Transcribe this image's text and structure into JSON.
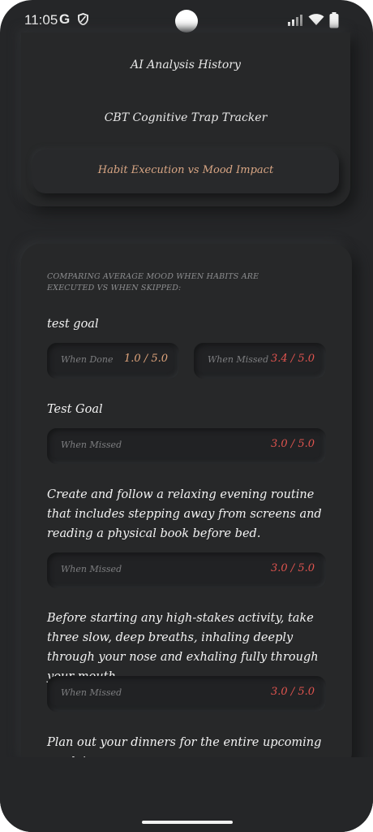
{
  "status": {
    "time": "11:05",
    "google": "G"
  },
  "nav": {
    "item1": "AI Analysis History",
    "item2": "CBT Cognitive Trap Tracker",
    "item3_active": "Habit Execution vs Mood Impact"
  },
  "main": {
    "subtitle": "COMPARING AVERAGE MOOD WHEN HABITS ARE EXECUTED VS WHEN SKIPPED:",
    "habits": [
      {
        "title": "test goal",
        "done_label": "When Done",
        "done_value": "1.0 / 5.0",
        "missed_label": "When Missed",
        "missed_value": "3.4 / 5.0"
      },
      {
        "title": "Test Goal",
        "missed_label": "When Missed",
        "missed_value": "3.0 / 5.0"
      },
      {
        "title": "Create and follow a relaxing evening routine that includes stepping away from screens and reading a physical book before bed.",
        "missed_label": "When Missed",
        "missed_value": "3.0 / 5.0"
      },
      {
        "title": "Before starting any high-stakes activity, take three slow, deep breaths, inhaling deeply through your nose and exhaling fully through your mouth.",
        "missed_label": "When Missed",
        "missed_value": "3.0 / 5.0"
      },
      {
        "title": "Plan out your dinners for the entire upcoming week in"
      }
    ]
  },
  "colors": {
    "background": "#252628",
    "accent_active": "#d9a684",
    "value_done": "#e0a57c",
    "value_missed": "#e0544f"
  }
}
